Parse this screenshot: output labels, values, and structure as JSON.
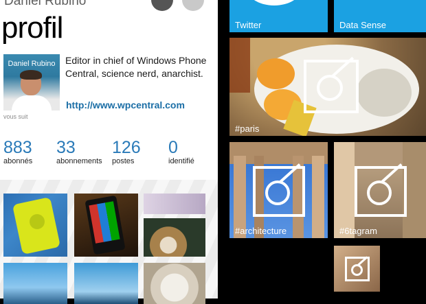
{
  "profile": {
    "username": "Daniel Rubino",
    "page_title": "profil",
    "avatar_name": "Daniel Rubino",
    "bio": "Editor in chief of Windows Phone Central, science nerd, anarchist.",
    "link": "http://www.wpcentral.com",
    "follows_you": "vous suit",
    "stats": [
      {
        "value": "883",
        "label": "abonnés"
      },
      {
        "value": "33",
        "label": "abonnements"
      },
      {
        "value": "126",
        "label": "postes"
      },
      {
        "value": "0",
        "label": "identifié"
      }
    ]
  },
  "tiles": {
    "twitter": "Twitter",
    "data_sense": "Data Sense",
    "paris": "#paris",
    "architecture": "#architecture",
    "sixtagram": "#6tagram"
  },
  "colors": {
    "accent_blue": "#1ba1e2",
    "link_blue": "#1b6ea6",
    "stat_blue": "#2a7ab8"
  },
  "icons": [
    "camera-icon",
    "instagram-icon",
    "twitter-bird-icon"
  ]
}
